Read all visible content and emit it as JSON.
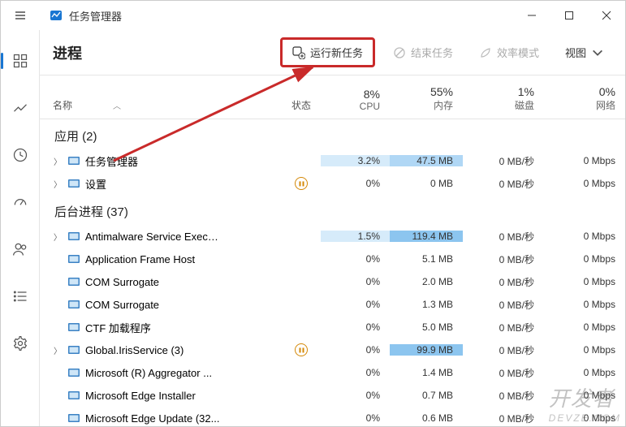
{
  "window": {
    "title": "任务管理器"
  },
  "toolbar": {
    "page_title": "进程",
    "new_task": "运行新任务",
    "end_task": "结束任务",
    "efficiency": "效率模式",
    "view": "视图"
  },
  "columns": {
    "name": "名称",
    "status": "状态",
    "cpu_pct": "8%",
    "cpu": "CPU",
    "mem_pct": "55%",
    "mem": "内存",
    "disk_pct": "1%",
    "disk": "磁盘",
    "net_pct": "0%",
    "net": "网络"
  },
  "groups": {
    "apps": "应用 (2)",
    "bg": "后台进程 (37)"
  },
  "apps": [
    {
      "exp": true,
      "name": "任务管理器",
      "paused": false,
      "cpu": "3.2%",
      "mem": "47.5 MB",
      "disk": "0 MB/秒",
      "net": "0 Mbps",
      "cpu_h": 1,
      "mem_h": 2
    },
    {
      "exp": true,
      "name": "设置",
      "paused": true,
      "cpu": "0%",
      "mem": "0 MB",
      "disk": "0 MB/秒",
      "net": "0 Mbps",
      "cpu_h": 0,
      "mem_h": 0
    }
  ],
  "bg": [
    {
      "exp": true,
      "name": "Antimalware Service Execut...",
      "paused": false,
      "cpu": "1.5%",
      "mem": "119.4 MB",
      "disk": "0 MB/秒",
      "net": "0 Mbps",
      "cpu_h": 1,
      "mem_h": 3
    },
    {
      "exp": false,
      "name": "Application Frame Host",
      "paused": false,
      "cpu": "0%",
      "mem": "5.1 MB",
      "disk": "0 MB/秒",
      "net": "0 Mbps",
      "cpu_h": 0,
      "mem_h": 0
    },
    {
      "exp": false,
      "name": "COM Surrogate",
      "paused": false,
      "cpu": "0%",
      "mem": "2.0 MB",
      "disk": "0 MB/秒",
      "net": "0 Mbps",
      "cpu_h": 0,
      "mem_h": 0
    },
    {
      "exp": false,
      "name": "COM Surrogate",
      "paused": false,
      "cpu": "0%",
      "mem": "1.3 MB",
      "disk": "0 MB/秒",
      "net": "0 Mbps",
      "cpu_h": 0,
      "mem_h": 0
    },
    {
      "exp": false,
      "name": "CTF 加载程序",
      "paused": false,
      "cpu": "0%",
      "mem": "5.0 MB",
      "disk": "0 MB/秒",
      "net": "0 Mbps",
      "cpu_h": 0,
      "mem_h": 0
    },
    {
      "exp": true,
      "name": "Global.IrisService (3)",
      "paused": true,
      "cpu": "0%",
      "mem": "99.9 MB",
      "disk": "0 MB/秒",
      "net": "0 Mbps",
      "cpu_h": 0,
      "mem_h": 3
    },
    {
      "exp": false,
      "name": "Microsoft (R) Aggregator ...",
      "paused": false,
      "cpu": "0%",
      "mem": "1.4 MB",
      "disk": "0 MB/秒",
      "net": "0 Mbps",
      "cpu_h": 0,
      "mem_h": 0
    },
    {
      "exp": false,
      "name": "Microsoft Edge Installer",
      "paused": false,
      "cpu": "0%",
      "mem": "0.7 MB",
      "disk": "0 MB/秒",
      "net": "0 Mbps",
      "cpu_h": 0,
      "mem_h": 0
    },
    {
      "exp": false,
      "name": "Microsoft Edge Update (32...",
      "paused": false,
      "cpu": "0%",
      "mem": "0.6 MB",
      "disk": "0 MB/秒",
      "net": "0 Mbps",
      "cpu_h": 0,
      "mem_h": 0
    }
  ],
  "watermark": {
    "main": "开发者",
    "sub": "DEVZE.COM"
  }
}
